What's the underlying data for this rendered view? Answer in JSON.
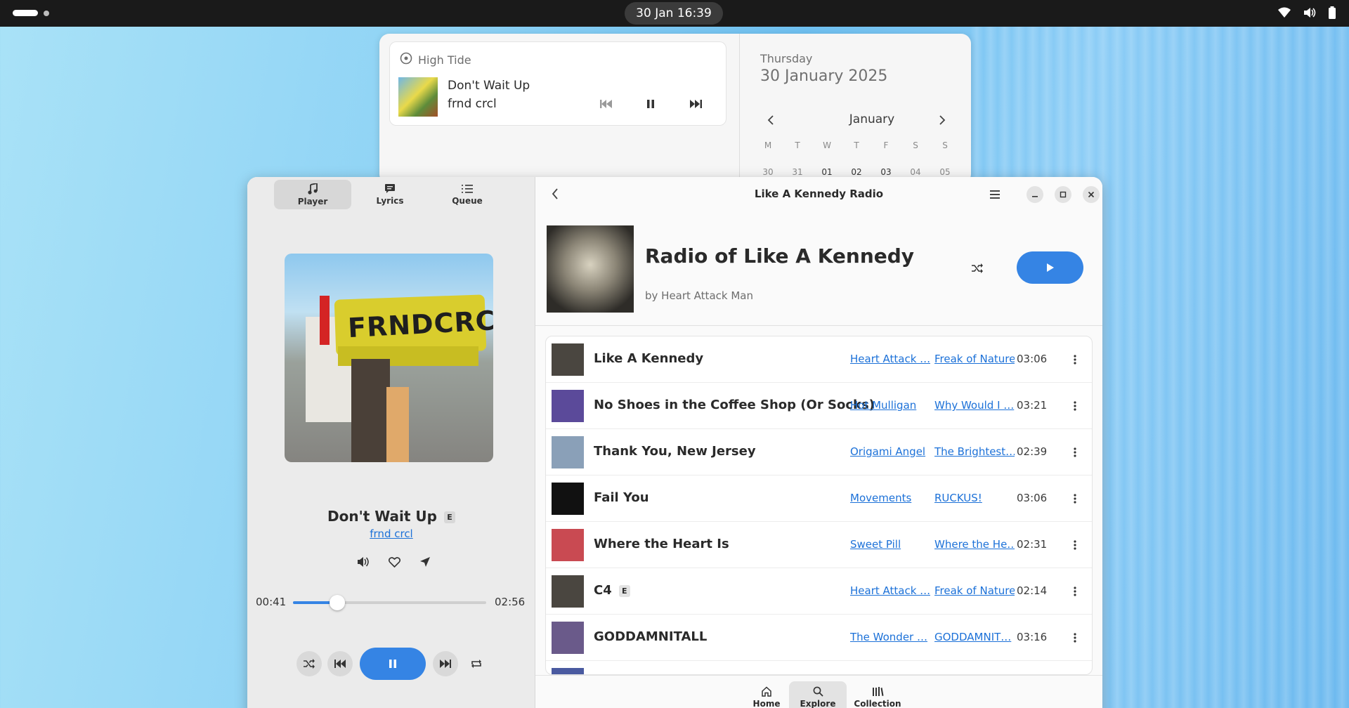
{
  "topbar": {
    "clock": "30 Jan  16:39",
    "icons": [
      "wifi-icon",
      "volume-icon",
      "battery-icon"
    ]
  },
  "notification": {
    "app_name": "High Tide",
    "title": "Don't Wait Up",
    "artist": "frnd crcl"
  },
  "calendar": {
    "weekday": "Thursday",
    "date": "30 January 2025",
    "month": "January",
    "day_headers": [
      "M",
      "T",
      "W",
      "T",
      "F",
      "S",
      "S"
    ],
    "first_row": [
      "30",
      "31",
      "01",
      "02",
      "03",
      "04",
      "05"
    ]
  },
  "player": {
    "tabs": [
      {
        "label": "Player",
        "icon": "music-note-icon"
      },
      {
        "label": "Lyrics",
        "icon": "speech-bubble-icon"
      },
      {
        "label": "Queue",
        "icon": "list-icon"
      }
    ],
    "active_tab": "Player",
    "art_text": "FRNDCRCL",
    "song_title": "Don't Wait Up",
    "explicit": "E",
    "artist": "frnd crcl",
    "elapsed": "00:41",
    "total": "02:56",
    "progress_fraction": 0.23
  },
  "page": {
    "title": "Like A Kennedy Radio",
    "hero_title": "Radio of Like A Kennedy",
    "hero_by": "by Heart Attack Man",
    "tracks": [
      {
        "title": "Like A Kennedy",
        "explicit": "",
        "artist": "Heart Attack …",
        "album": "Freak of Nature",
        "duration": "03:06",
        "thumb_color": "#4a4640"
      },
      {
        "title": "No Shoes in the Coffee Shop (Or Socks)",
        "explicit": "",
        "artist": "Hot Mulligan",
        "album": "Why Would I …",
        "duration": "03:21",
        "thumb_color": "#5b4a9a"
      },
      {
        "title": "Thank You, New Jersey",
        "explicit": "",
        "artist": "Origami Angel",
        "album": "The Brightest…",
        "duration": "02:39",
        "thumb_color": "#8aa0b8"
      },
      {
        "title": "Fail You",
        "explicit": "",
        "artist": "Movements",
        "album": "RUCKUS!",
        "duration": "03:06",
        "thumb_color": "#111111"
      },
      {
        "title": "Where the Heart Is",
        "explicit": "",
        "artist": "Sweet Pill",
        "album": "Where the He…",
        "duration": "02:31",
        "thumb_color": "#c94a52"
      },
      {
        "title": "C4",
        "explicit": "E",
        "artist": "Heart Attack …",
        "album": "Freak of Nature",
        "duration": "02:14",
        "thumb_color": "#4a4640"
      },
      {
        "title": "GODDAMNITALL",
        "explicit": "",
        "artist": "The Wonder …",
        "album": "GODDAMNIT…",
        "duration": "03:16",
        "thumb_color": "#6a5a8a"
      },
      {
        "title": "",
        "explicit": "",
        "artist": "",
        "album": "",
        "duration": "",
        "thumb_color": "#4a5aa0"
      }
    ]
  },
  "bottom_nav": [
    {
      "label": "Home",
      "icon": "home-icon"
    },
    {
      "label": "Explore",
      "icon": "search-icon"
    },
    {
      "label": "Collection",
      "icon": "library-icon"
    }
  ],
  "bottom_nav_active": "Explore",
  "colors": {
    "accent": "#3584e4",
    "link": "#1c71d8"
  }
}
